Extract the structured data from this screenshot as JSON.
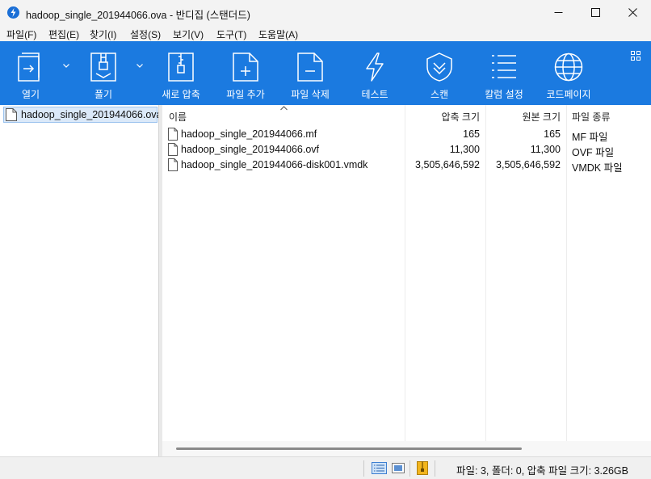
{
  "window": {
    "title": "hadoop_single_201944066.ova - 반디집 (스탠더드)",
    "accent_color": "#1b7ae0"
  },
  "menu": [
    "파일(F)",
    "편집(E)",
    "찾기(I)",
    "설정(S)",
    "보기(V)",
    "도구(T)",
    "도움말(A)"
  ],
  "toolbar": {
    "open": "열기",
    "extract": "풀기",
    "new_archive": "새로 압축",
    "add_files": "파일 추가",
    "delete_files": "파일 삭제",
    "test": "테스트",
    "scan": "스캔",
    "column_settings": "칼럼 설정",
    "codepage": "코드페이지"
  },
  "tree": {
    "root": "hadoop_single_201944066.ova"
  },
  "columns": {
    "name": "이름",
    "compressed": "압축 크기",
    "original": "원본 크기",
    "type": "파일 종류"
  },
  "files": [
    {
      "name": "hadoop_single_201944066.mf",
      "compressed": "165",
      "original": "165",
      "type": "MF 파일"
    },
    {
      "name": "hadoop_single_201944066.ovf",
      "compressed": "11,300",
      "original": "11,300",
      "type": "OVF 파일"
    },
    {
      "name": "hadoop_single_201944066-disk001.vmdk",
      "compressed": "3,505,646,592",
      "original": "3,505,646,592",
      "type": "VMDK 파일"
    }
  ],
  "status": {
    "summary": "파일: 3, 폴더: 0, 압축 파일 크기: 3.26GB"
  }
}
